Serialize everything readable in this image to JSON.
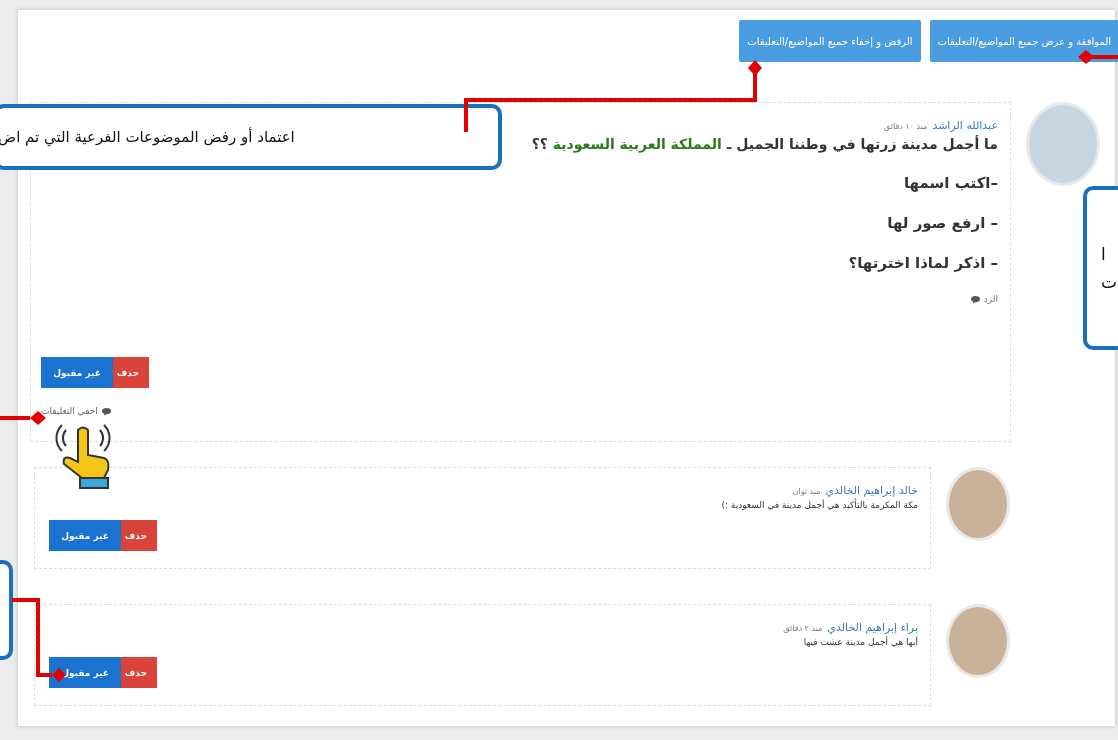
{
  "toolbar": {
    "buttons": [
      {
        "label": "الموافقة و عرض جميع المواضيع/التعليقات"
      },
      {
        "label": "الرفض و إخفاء جميع المواضيع/التعليقات"
      }
    ]
  },
  "post": {
    "author": "عبدالله الراشد",
    "time": "منذ ١٠ دقائق",
    "title": {
      "text": "ما أجمل مدينة زرتها في وطننا الجميل ـ ",
      "highlight": "المملكة العربية السعودية",
      "end": " ؟؟"
    },
    "lines": [
      "–اكتب اسمها",
      "– ارفع صور لها",
      "– اذكر لماذا اخترتها؟"
    ],
    "reply_link": "الرد",
    "actions": [
      {
        "kind": "delete",
        "label": "حذف"
      },
      {
        "kind": "reject",
        "label": "غير مقبول"
      }
    ],
    "toggle_comments": "اخفي التعليقات"
  },
  "comments": [
    {
      "author": "خالد إبراهيم الخالدي",
      "time": "منذ ثوان",
      "text": "مكة المكرمة بالتأكيد هي أجمل مدينة في السعودية :)",
      "actions": [
        {
          "kind": "delete",
          "label": "حذف"
        },
        {
          "kind": "reject",
          "label": "غير مقبول"
        }
      ]
    },
    {
      "author": "براء إبراهيم الخالدي",
      "time": "منذ ٢ دقائق",
      "text": "أبها هي أجمل مدينة عشت فيها",
      "actions": [
        {
          "kind": "delete",
          "label": "حذف"
        },
        {
          "kind": "reject",
          "label": "غير مقبول"
        }
      ]
    }
  ],
  "callout_top": {
    "text": "اعتماد أو رفض الموضوعات الفرعية التي تم اض"
  },
  "callout_right": {
    "lines": [
      "ا",
      "ت"
    ]
  }
}
